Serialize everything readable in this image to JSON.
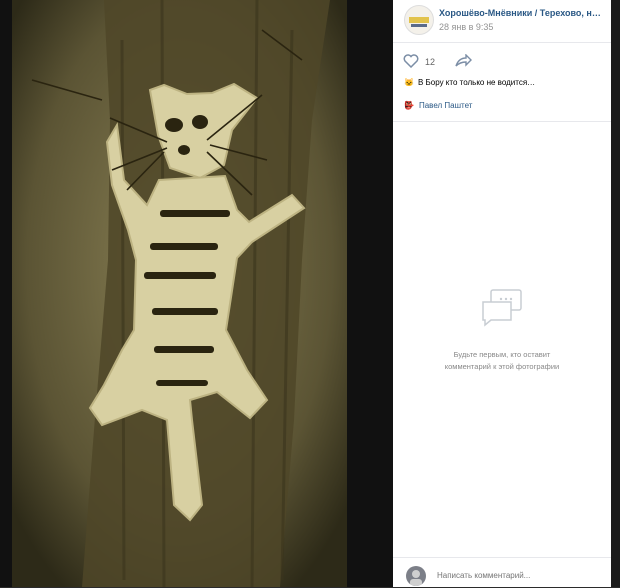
{
  "post": {
    "group_name": "Хорошёво-Мнёвники / Терехово, н…",
    "date": "28 янв в 9:35",
    "likes": "12",
    "caption_emoji": "🐱",
    "caption_text": "В Бору кто только не водится…",
    "author_emoji": "👺",
    "author_name": "Павел Паштет"
  },
  "comments": {
    "empty_line1": "Будьте первым, кто оставит",
    "empty_line2": "комментарий к этой фотографии",
    "input_placeholder": "Написать комментарий..."
  },
  "colors": {
    "link": "#2a5885",
    "photo_tone": "#6b6540",
    "snow": "#d8d0a2"
  }
}
